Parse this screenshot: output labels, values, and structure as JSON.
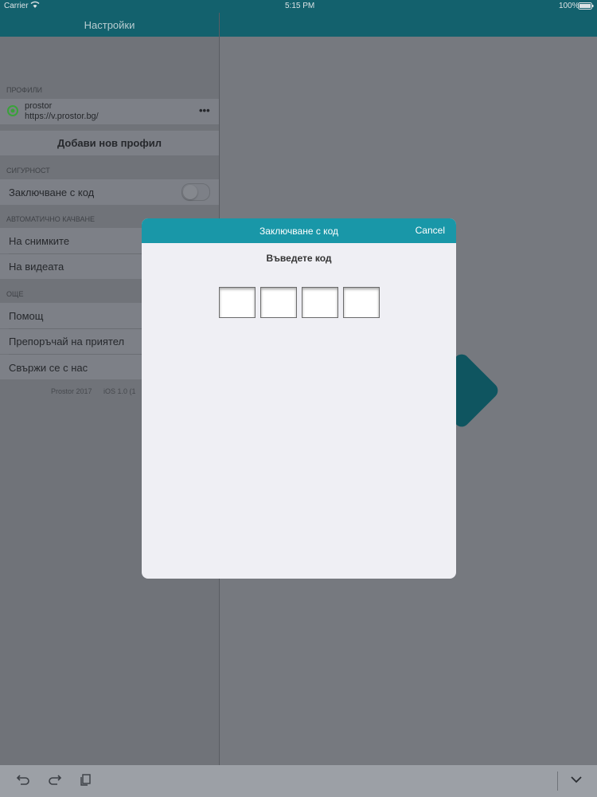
{
  "status_bar": {
    "carrier": "Carrier",
    "time": "5:15 PM",
    "battery": "100%"
  },
  "nav": {
    "title": "Настройки"
  },
  "profiles": {
    "header": "ПРОФИЛИ",
    "items": [
      {
        "name": "prostor",
        "url": "https://v.prostor.bg/",
        "menu": "•••"
      }
    ],
    "add_label": "Добави нов профил"
  },
  "security": {
    "header": "СИГУРНОСТ",
    "passcode_label": "Заключване с код"
  },
  "auto_upload": {
    "header": "АВТОМАТИЧНО КАЧВАНЕ",
    "photos_label": "На снимките",
    "videos_label": "На видеата"
  },
  "more": {
    "header": "ОЩЕ",
    "items": [
      "Помощ",
      "Препоръчай на приятел",
      "Свържи се с нас"
    ]
  },
  "footer": {
    "copyright": "Prostor 2017",
    "version": "iOS 1.0 (1"
  },
  "modal": {
    "title": "Заключване с код",
    "cancel_label": "Cancel",
    "prompt": "Въведете код",
    "code_length": 4
  },
  "toolbar": {
    "undo_icon": "undo-icon",
    "redo_icon": "redo-icon",
    "clipboard_icon": "clipboard-icon",
    "dismiss_icon": "chevron-down-icon"
  },
  "colors": {
    "nav": "#13616d",
    "modal_header": "#1997a8",
    "status_green": "#3aa13a"
  }
}
